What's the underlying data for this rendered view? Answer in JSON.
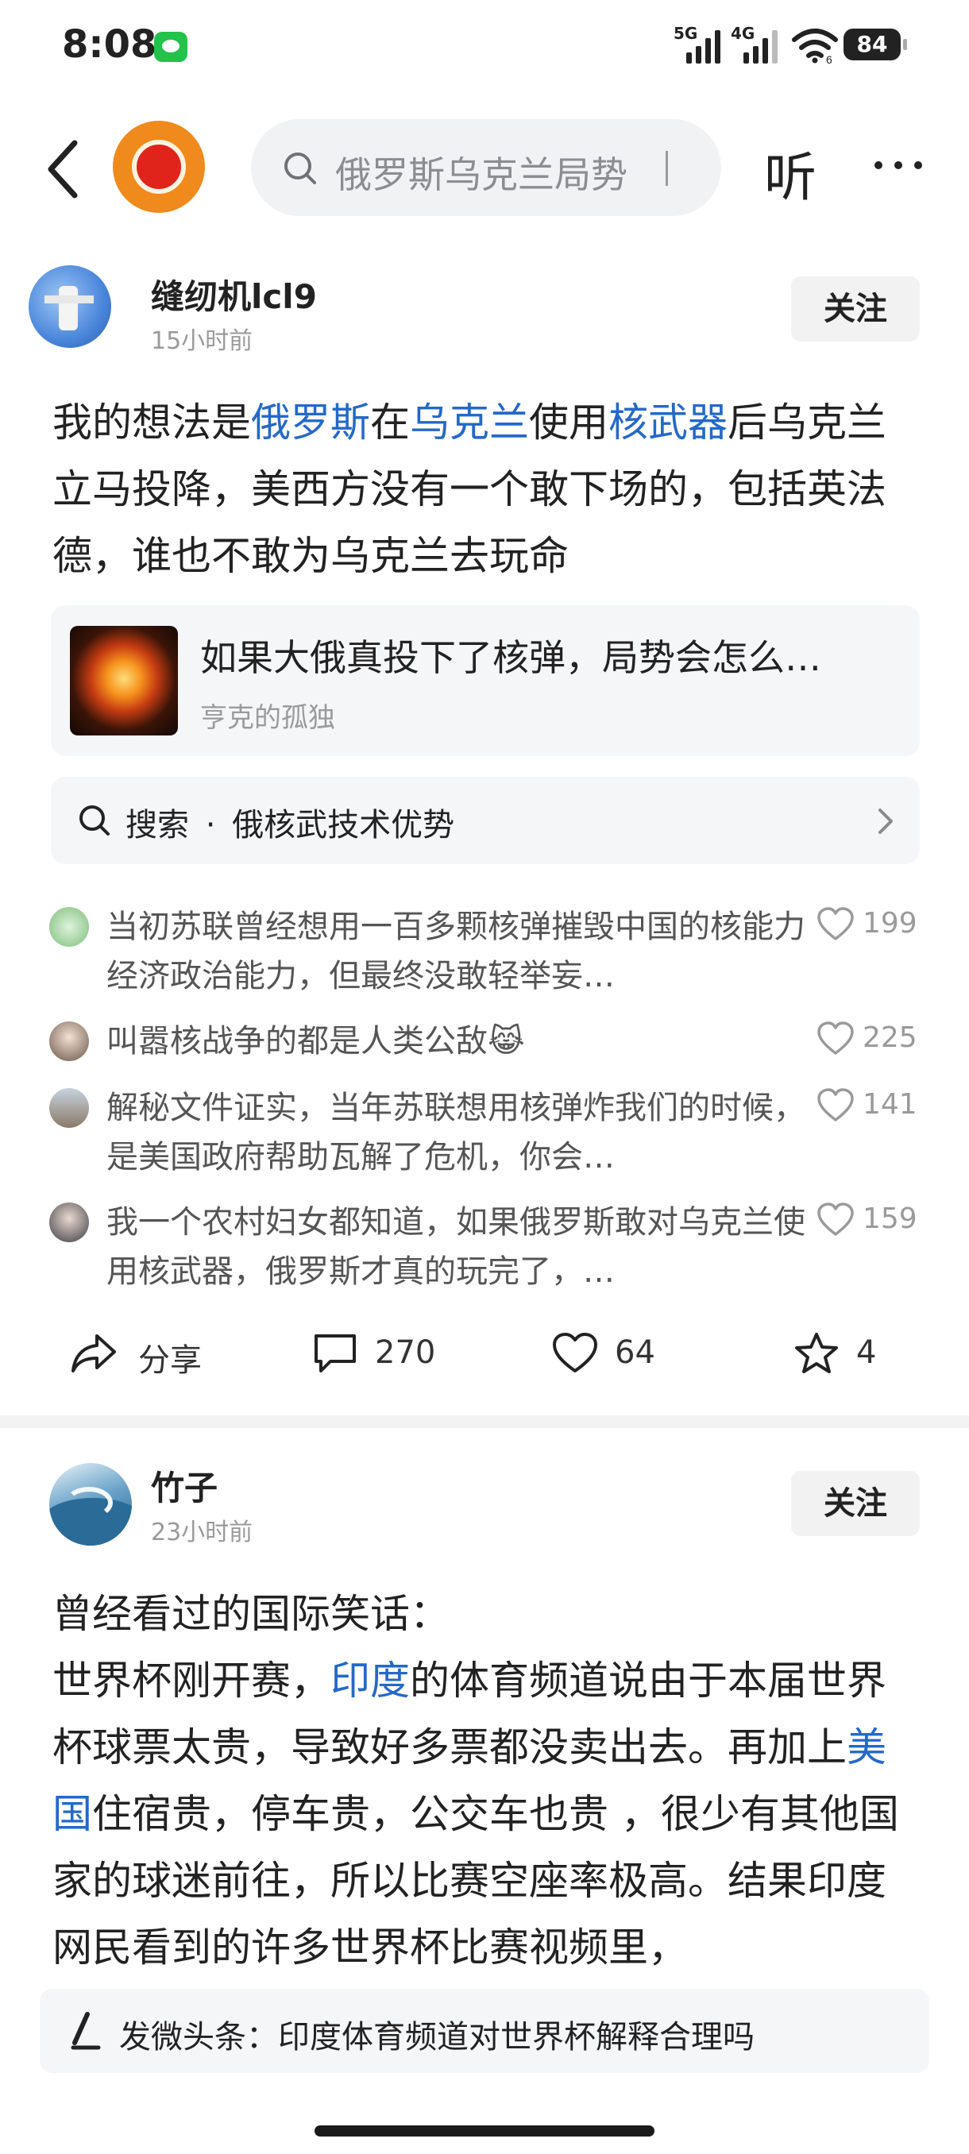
{
  "status_bar": {
    "time": "8:08",
    "signal_1_label": "5G",
    "signal_2_label": "4G",
    "wifi_label": "6",
    "battery": "84"
  },
  "header": {
    "search_placeholder": "俄罗斯乌克兰局势",
    "listen_label": "听"
  },
  "posts": [
    {
      "author": "缝纫机lcl9",
      "time": "15小时前",
      "follow_label": "关注",
      "text_segments": [
        {
          "t": "我的想法是",
          "kw": false
        },
        {
          "t": "俄罗斯",
          "kw": true
        },
        {
          "t": "在",
          "kw": false
        },
        {
          "t": "乌克兰",
          "kw": true
        },
        {
          "t": "使用",
          "kw": false
        },
        {
          "t": "核武器",
          "kw": true
        },
        {
          "t": "后乌克兰立马投降，美西方没有一个敢下场的，包括英法德，谁也不敢为乌克兰去玩命",
          "kw": false
        }
      ],
      "link_card": {
        "title": "如果大俄真投下了核弹，局势会怎么…",
        "source": "亨克的孤独"
      },
      "search_suggestion": {
        "prefix": "搜索",
        "dot": "·",
        "query": "俄核武技术优势"
      },
      "comments": [
        {
          "text": "当初苏联曾经想用一百多颗核弹摧毁中国的核能力经济政治能力，但最终没敢轻举妄…",
          "likes": "199"
        },
        {
          "text": "叫嚣核战争的都是人类公敌😹",
          "likes": "225"
        },
        {
          "text": "解秘文件证实，当年苏联想用核弹炸我们的时候，是美国政府帮助瓦解了危机，你会…",
          "likes": "141"
        },
        {
          "text": "我一个农村妇女都知道，如果俄罗斯敢对乌克兰使用核武器，俄罗斯才真的玩完了，…",
          "likes": "159"
        }
      ],
      "actions": {
        "share": "分享",
        "comments": "270",
        "likes": "64",
        "favorites": "4"
      }
    },
    {
      "author": "竹子",
      "time": "23小时前",
      "follow_label": "关注",
      "text_segments": [
        {
          "t": "曾经看过的国际笑话：",
          "kw": false,
          "br": true
        },
        {
          "t": "世界杯刚开赛，",
          "kw": false
        },
        {
          "t": "印度",
          "kw": true
        },
        {
          "t": "的体育频道说由于本届世界杯球票太贵，导致好多票都没卖出去。再加上",
          "kw": false
        },
        {
          "t": "美国",
          "kw": true
        },
        {
          "t": "住宿贵，停车贵，公交车也贵 ，很少有其他国家的球迷前往，所以比赛空座率极高。结果印度网民看到的许多世界杯比赛视频里，",
          "kw": false
        }
      ]
    }
  ],
  "bottom_bar": {
    "label": "发微头条：印度体育频道对世界杯解释合理吗"
  }
}
